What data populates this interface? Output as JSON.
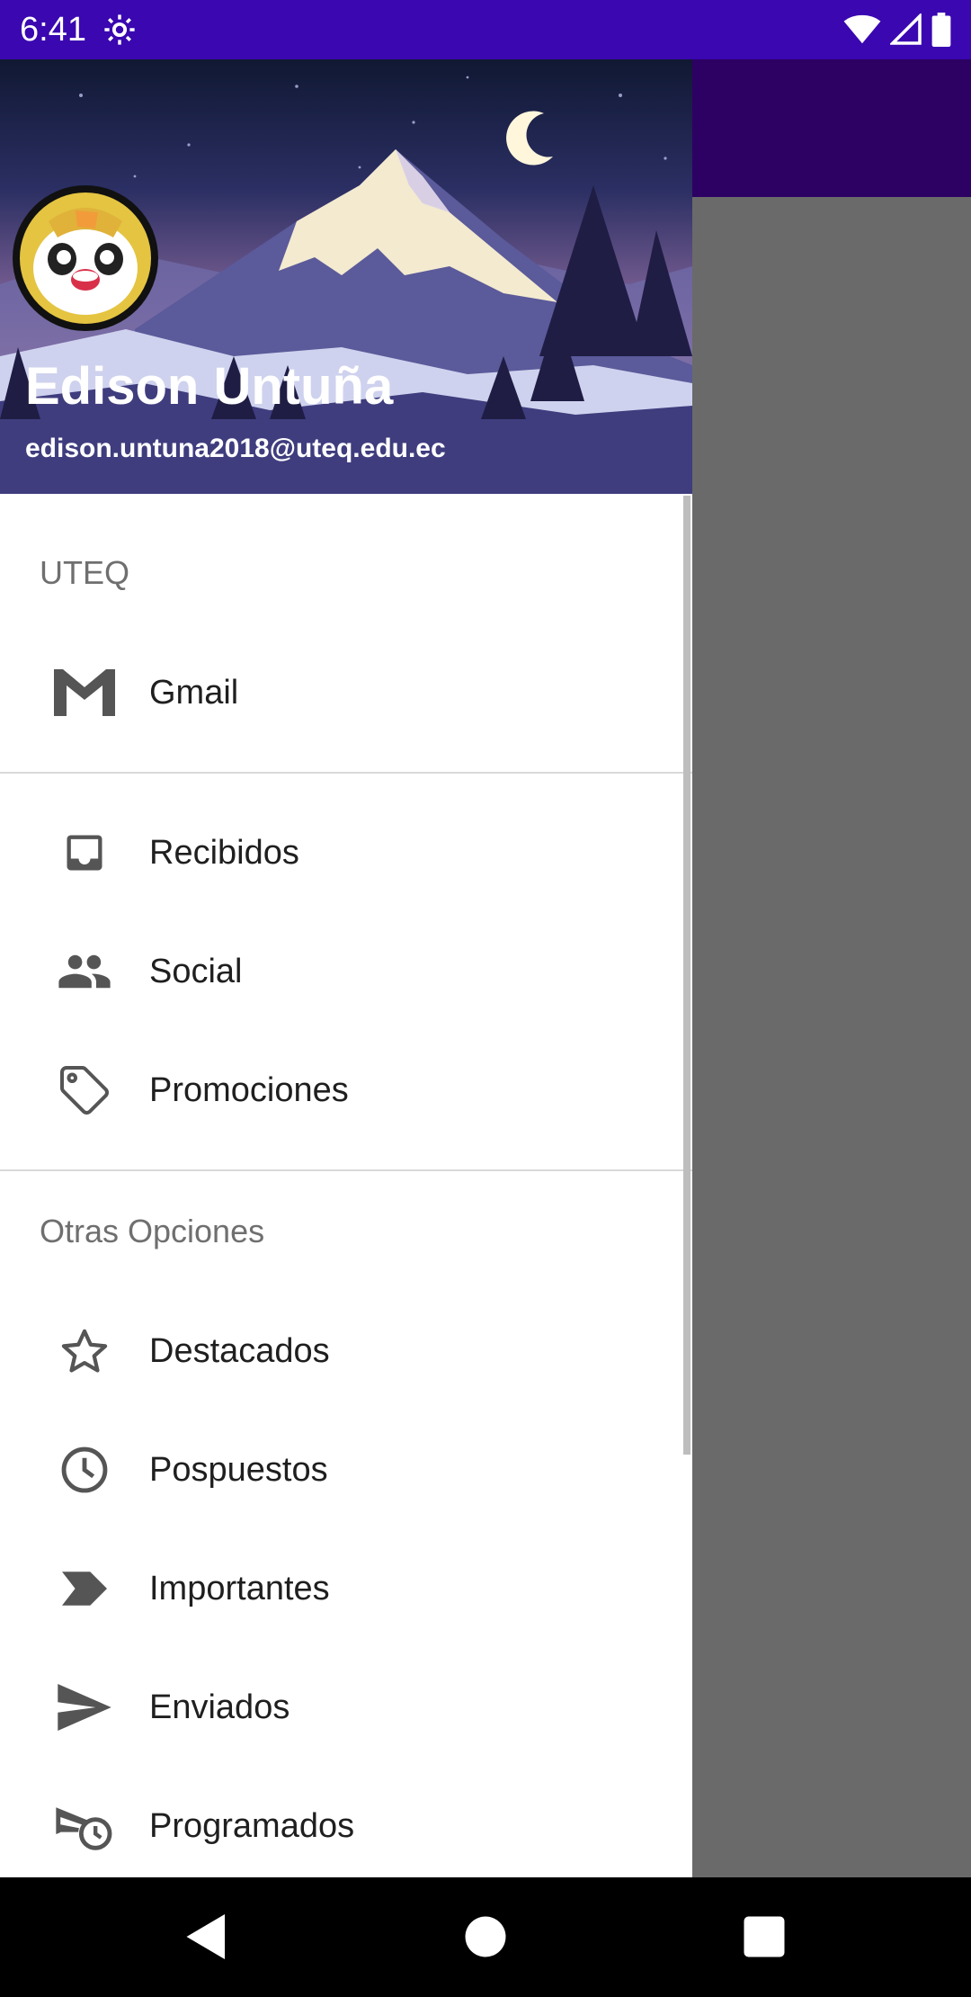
{
  "status_bar": {
    "time": "6:41"
  },
  "drawer": {
    "header": {
      "name": "Edison Untuña",
      "email": "edison.untuna2018@uteq.edu.ec"
    },
    "sections": [
      {
        "title": "UTEQ",
        "items": [
          {
            "label": "Gmail",
            "icon": "gmail-icon"
          }
        ]
      },
      {
        "title": "",
        "items": [
          {
            "label": "Recibidos",
            "icon": "inbox-icon"
          },
          {
            "label": "Social",
            "icon": "people-icon"
          },
          {
            "label": "Promociones",
            "icon": "tag-icon"
          }
        ]
      },
      {
        "title": "Otras Opciones",
        "items": [
          {
            "label": "Destacados",
            "icon": "star-icon"
          },
          {
            "label": "Pospuestos",
            "icon": "clock-icon"
          },
          {
            "label": "Importantes",
            "icon": "label-important-icon"
          },
          {
            "label": "Enviados",
            "icon": "send-icon"
          },
          {
            "label": "Programados",
            "icon": "schedule-send-icon"
          }
        ]
      }
    ]
  },
  "colors": {
    "status_bar": "#3a07b0",
    "app_bar": "#2d0063",
    "scrim": "#6a6a6a",
    "icon": "#555555"
  }
}
